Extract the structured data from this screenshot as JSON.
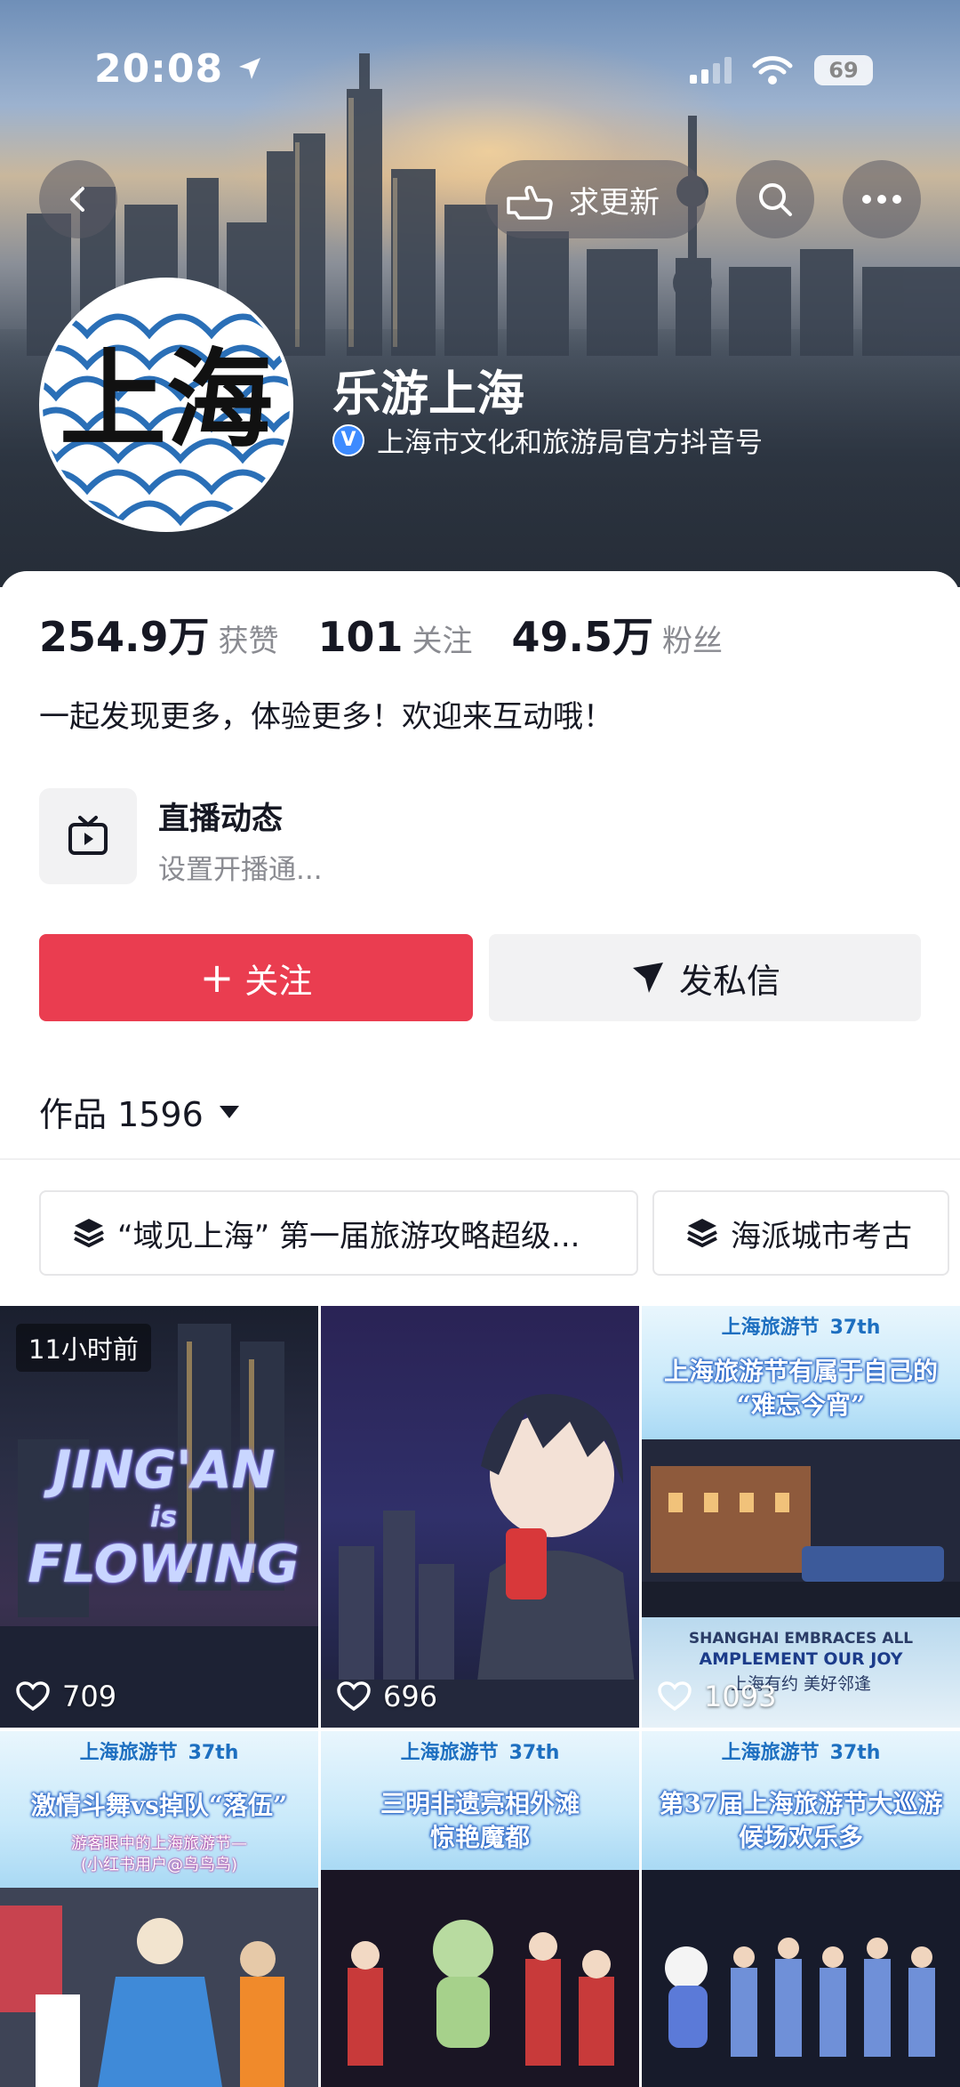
{
  "status": {
    "time": "20:08",
    "battery": "69"
  },
  "header": {
    "request_update_label": "求更新"
  },
  "profile": {
    "name": "乐游上海",
    "verification": "上海市文化和旅游局官方抖音号",
    "avatar_text": "上海"
  },
  "stats": [
    {
      "num": "254.9万",
      "label": "获赞"
    },
    {
      "num": "101",
      "label": "关注"
    },
    {
      "num": "49.5万",
      "label": "粉丝"
    }
  ],
  "bio": "一起发现更多，体验更多！欢迎来互动哦！",
  "live": {
    "title": "直播动态",
    "subtitle": "设置开播通..."
  },
  "actions": {
    "follow": "关注",
    "message": "发私信"
  },
  "works": {
    "label": "作品 1596"
  },
  "collections": [
    "“域见上海” 第一届旅游攻略超级...",
    "海派城市考古"
  ],
  "videos": [
    {
      "likes": "709",
      "badge": "11小时前",
      "overlay": [
        "JING'AN",
        "is",
        "FLOWING"
      ]
    },
    {
      "likes": "696"
    },
    {
      "likes": "1093",
      "fest": "上海旅游节",
      "fest_num": "37th",
      "title_lines": [
        "上海旅游节有属于自己的",
        "“难忘今宵”"
      ],
      "bottom_lines": [
        "SHANGHAI EMBRACES ALL",
        "AMPLEMENT OUR JOY",
        "上海有约 美好邻逢"
      ]
    },
    {
      "fest": "上海旅游节",
      "fest_num": "37th",
      "title_lines": [
        "激情斗舞vs掉队“落伍”"
      ],
      "sub_lines": [
        "游客眼中的上海旅游节—",
        "(小红书用户@鸟鸟鸟)"
      ]
    },
    {
      "fest": "上海旅游节",
      "fest_num": "37th",
      "title_lines": [
        "三明非遗亮相外滩",
        "惊艳魔都"
      ]
    },
    {
      "fest": "上海旅游节",
      "fest_num": "37th",
      "title_lines": [
        "第37届上海旅游节大巡游",
        "候场欢乐多"
      ]
    }
  ],
  "colors": {
    "follow": "#ea3d50",
    "verify": "#3d8bff",
    "accent_text": "#161823"
  }
}
